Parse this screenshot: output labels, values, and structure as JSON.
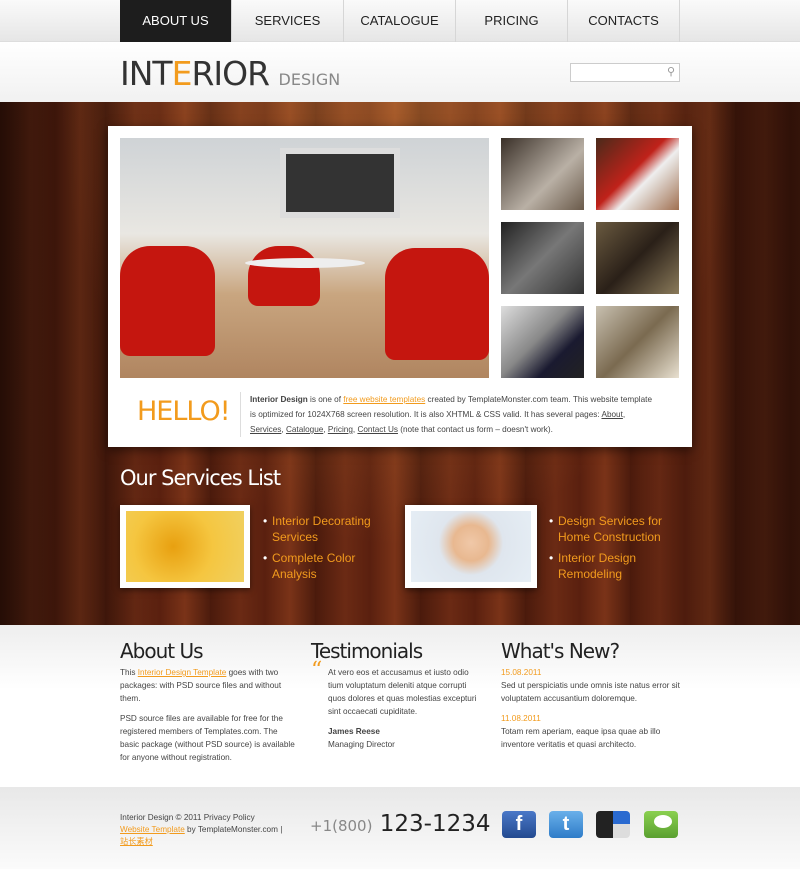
{
  "nav": {
    "items": [
      {
        "label": "About Us",
        "active": true
      },
      {
        "label": "Services"
      },
      {
        "label": "Catalogue"
      },
      {
        "label": "Pricing"
      },
      {
        "label": "Contacts"
      }
    ]
  },
  "header": {
    "logo_part1": "INT",
    "logo_highlight": "E",
    "logo_part2": "RIOR",
    "logo_sub": "DESIGN",
    "search_placeholder": "",
    "search_icon": "magnifier-icon"
  },
  "hero": {
    "hello": "HELLO!",
    "intro_bold": "Interior Design",
    "intro_1": " is one of ",
    "intro_link": "free website templates",
    "intro_2": " created by TemplateMonster.com team. This website template is optimized for 1024X768 screen resolution. It is also XHTML & CSS valid. It has several pages: ",
    "pages": [
      "About",
      "Services",
      "Catalogue",
      "Pricing",
      "Contact Us"
    ],
    "intro_3": " (note that contact us form – doesn't work)."
  },
  "services": {
    "title": "Our Services List",
    "groups": [
      {
        "items": [
          "Interior Decorating Services",
          "Complete Color Analysis"
        ]
      },
      {
        "items": [
          "Design Services for Home Construction",
          "Interior Design Remodeling"
        ]
      }
    ]
  },
  "about": {
    "title": "About Us",
    "p1_a": "This ",
    "p1_link": "Interior Design Template",
    "p1_b": " goes with two packages: with PSD source files and without them.",
    "p2": "PSD source files are available for free for the registered members of Templates.com. The basic package (without PSD source) is available for anyone without registration."
  },
  "testimonials": {
    "title": "Testimonials",
    "quote": "At vero eos et accusamus et iusto odio tium voluptatum deleniti atque corrupti quos dolores et quas molestias excepturi sint occaecati cupiditate.",
    "author": "James Reese",
    "role": "Managing Director"
  },
  "news": {
    "title": "What's New?",
    "items": [
      {
        "date": "15.08.2011",
        "text": "Sed ut perspiciatis unde omnis iste natus error sit voluptatem accusantium doloremque."
      },
      {
        "date": "11.08.2011",
        "text": "Totam rem aperiam, eaque ipsa quae ab illo inventore veritatis et quasi architecto."
      }
    ]
  },
  "footer": {
    "copy": "Interior Design © 2011 Privacy Policy",
    "link": "Website Template",
    "by": " by TemplateMonster.com | ",
    "cn_link": "站长素材",
    "phone_prefix": "+1(800)",
    "phone": "123-1234",
    "social": [
      {
        "icon": "facebook-icon",
        "glyph": "f",
        "color": "#2d5aa8"
      },
      {
        "icon": "twitter-icon",
        "glyph": "t",
        "color": "#3a8fd6"
      },
      {
        "icon": "delicious-icon",
        "glyph": "",
        "color": "#333"
      },
      {
        "icon": "technorati-icon",
        "glyph": "",
        "color": "#6cb43f"
      }
    ]
  },
  "colors": {
    "accent": "#f29b1d",
    "nav_active": "#1d1d1d"
  }
}
